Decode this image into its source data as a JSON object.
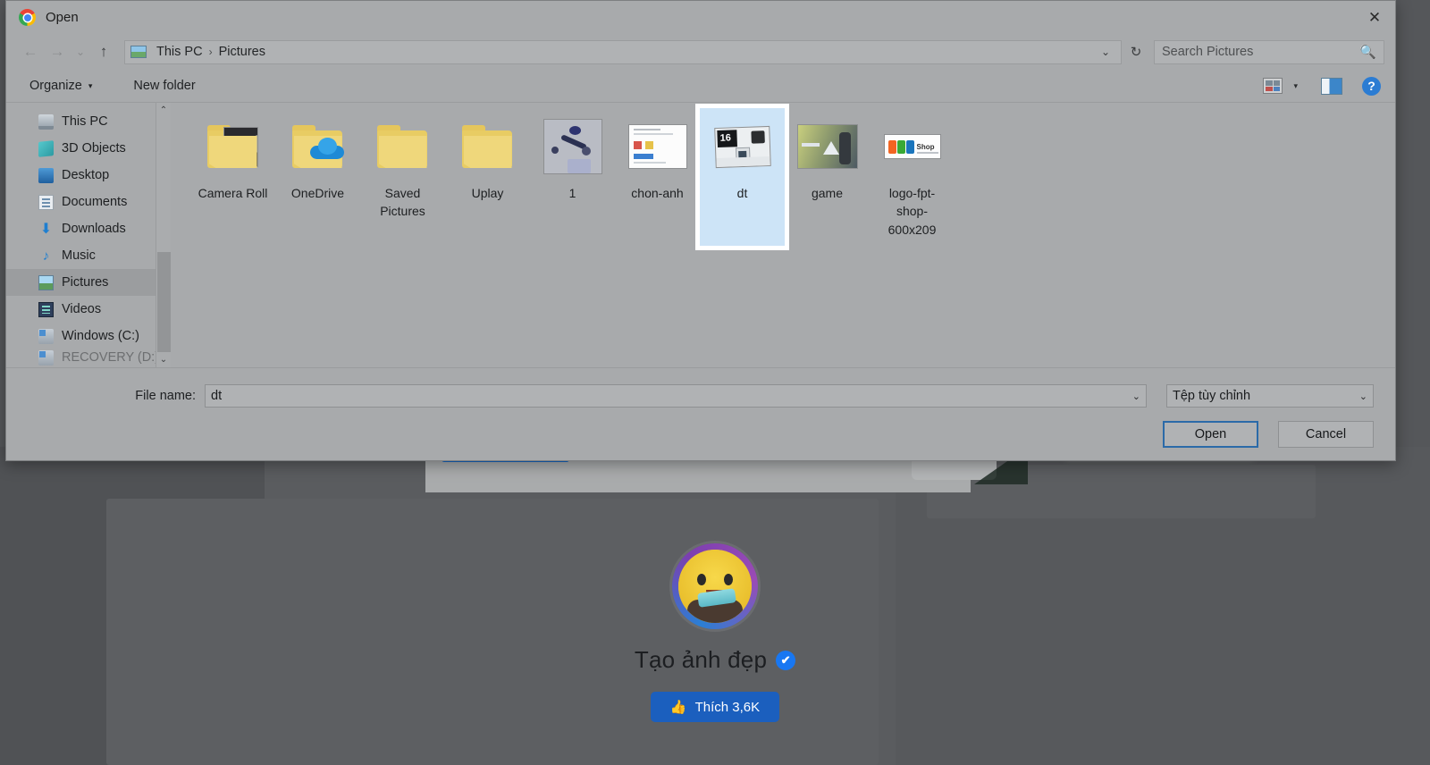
{
  "background": {
    "profile_name": "Tạo ảnh đẹp",
    "verified_mark": "✔",
    "like_label": "Thích 3,6K",
    "like_icon": "thumbs-up-icon"
  },
  "dialog": {
    "title": "Open",
    "app_icon": "chrome-logo-icon",
    "close_icon": "✕",
    "nav": {
      "back_icon": "←",
      "forward_icon": "→",
      "history_icon": "⌄",
      "up_icon": "↑",
      "refresh_icon": "↻",
      "address_chevron": "⌄",
      "breadcrumb": [
        "This PC",
        "Pictures"
      ],
      "breadcrumb_separator": "›"
    },
    "search": {
      "placeholder": "Search Pictures",
      "icon": "🔍"
    },
    "commandbar": {
      "organize_label": "Organize",
      "organize_caret": "▾",
      "new_folder_label": "New folder",
      "view_caret": "▾",
      "view_icon": "view-options-icon",
      "preview_icon": "preview-pane-icon",
      "help_icon": "?"
    },
    "sidebar": {
      "items": [
        {
          "label": "This PC",
          "icon": "pc-icon",
          "selected": false
        },
        {
          "label": "3D Objects",
          "icon": "3d-objects-icon",
          "selected": false
        },
        {
          "label": "Desktop",
          "icon": "desktop-icon",
          "selected": false
        },
        {
          "label": "Documents",
          "icon": "documents-icon",
          "selected": false
        },
        {
          "label": "Downloads",
          "icon": "downloads-icon",
          "selected": false
        },
        {
          "label": "Music",
          "icon": "music-icon",
          "selected": false
        },
        {
          "label": "Pictures",
          "icon": "pictures-icon",
          "selected": true
        },
        {
          "label": "Videos",
          "icon": "videos-icon",
          "selected": false
        },
        {
          "label": "Windows (C:)",
          "icon": "drive-icon",
          "selected": false
        },
        {
          "label": "RECOVERY (D:)",
          "icon": "drive-icon",
          "selected": false
        }
      ],
      "scroll_up_icon": "⌃",
      "scroll_down_icon": "⌄"
    },
    "files": [
      {
        "name": "Camera Roll",
        "kind": "folder-photo"
      },
      {
        "name": "OneDrive",
        "kind": "folder-cloud"
      },
      {
        "name": "Saved Pictures",
        "kind": "folder"
      },
      {
        "name": "Uplay",
        "kind": "folder"
      },
      {
        "name": "1",
        "kind": "image-flatlay"
      },
      {
        "name": "chon-anh",
        "kind": "image-screenshot"
      },
      {
        "name": "dt",
        "kind": "image-desk",
        "selected": true
      },
      {
        "name": "game",
        "kind": "image-game"
      },
      {
        "name": "logo-fpt-shop-600x209",
        "kind": "image-logo"
      }
    ],
    "footer": {
      "filename_label": "File name:",
      "filename_value": "dt",
      "filename_caret": "⌄",
      "filetype_value": "Tệp tùy chỉnh",
      "filetype_caret": "⌄",
      "open_label": "Open",
      "cancel_label": "Cancel"
    }
  },
  "colors": {
    "dialog_bg": "#a8aaac",
    "selection_blue": "#cde4f7",
    "accent_blue": "#2b6aa8",
    "facebook_blue": "#1b5fbe"
  }
}
